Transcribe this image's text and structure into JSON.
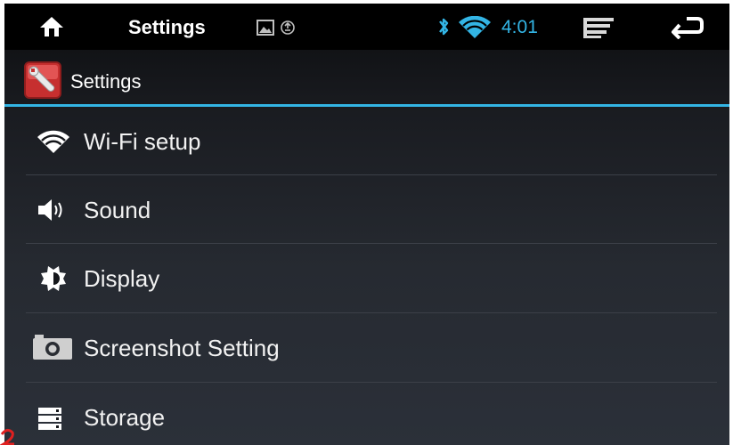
{
  "status_bar": {
    "title": "Settings",
    "time": "4:01",
    "icons": [
      "home-icon",
      "picture-icon",
      "sync-icon",
      "bluetooth-icon",
      "wifi-icon",
      "menu-icon",
      "back-icon"
    ],
    "time_color": "#33b5e5"
  },
  "action_bar": {
    "title": "Settings",
    "icon": "settings-wrench-icon",
    "accent_color": "#33b5e5"
  },
  "settings_list": {
    "items": [
      {
        "label": "Wi-Fi setup",
        "icon": "wifi-icon"
      },
      {
        "label": "Sound",
        "icon": "speaker-icon"
      },
      {
        "label": "Display",
        "icon": "brightness-icon"
      },
      {
        "label": "Screenshot Setting",
        "icon": "camera-icon"
      },
      {
        "label": "Storage",
        "icon": "storage-icon"
      }
    ]
  }
}
